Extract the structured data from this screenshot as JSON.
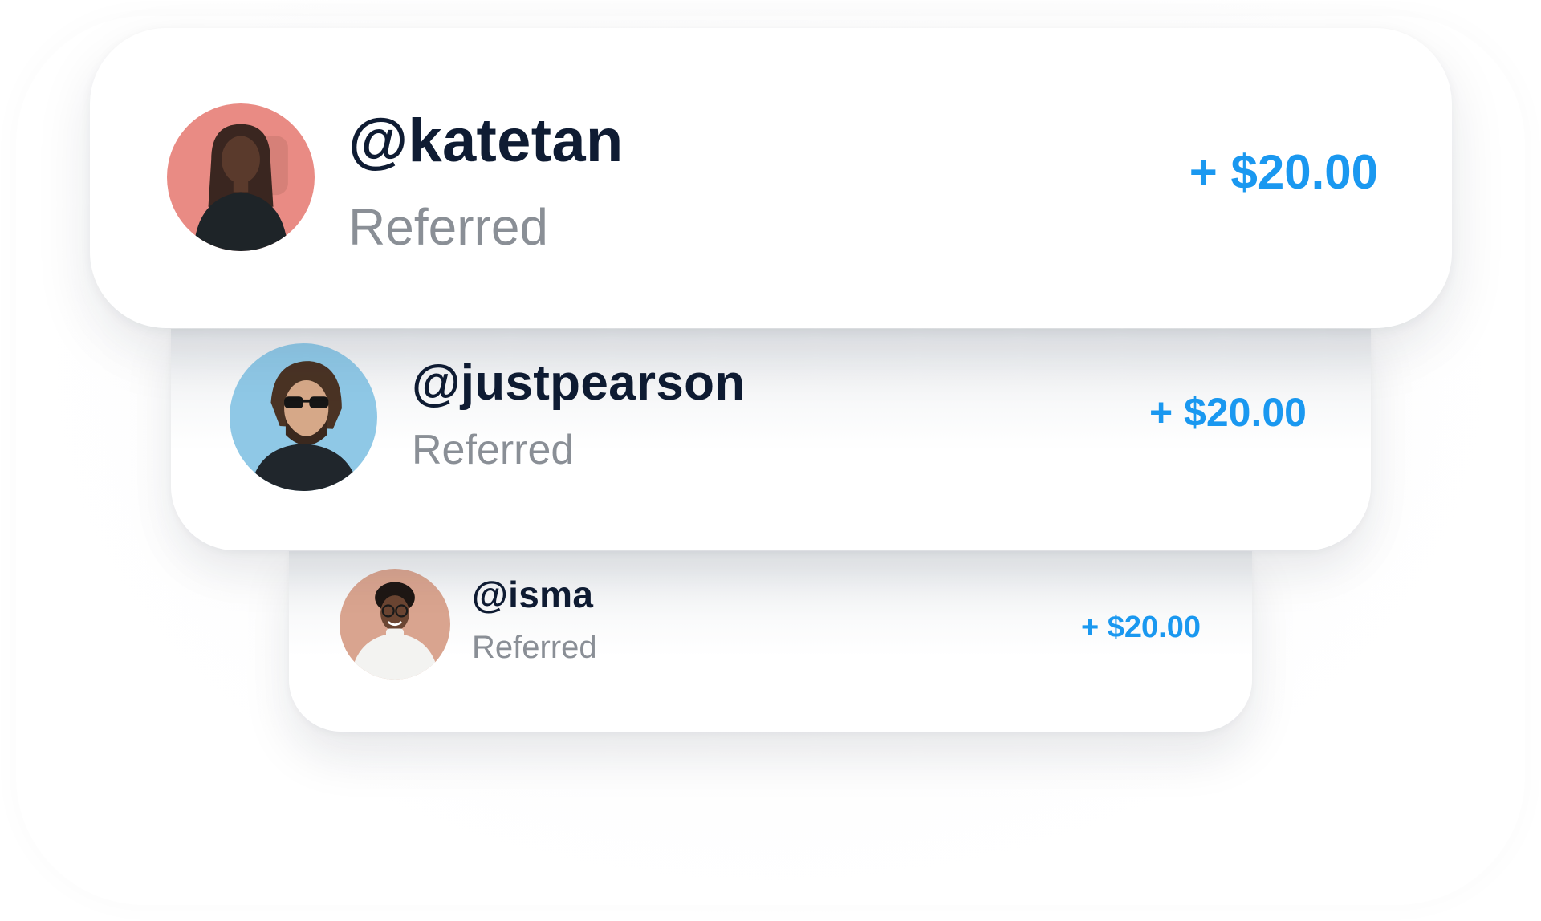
{
  "referrals": [
    {
      "handle": "@katetan",
      "status": "Referred",
      "amount": "+ $20.00",
      "avatar_icon": "person-avatar-icon",
      "avatar_bg": "#e98b84"
    },
    {
      "handle": "@justpearson",
      "status": "Referred",
      "amount": "+ $20.00",
      "avatar_icon": "person-avatar-icon",
      "avatar_bg": "#8fc8e6"
    },
    {
      "handle": "@isma",
      "status": "Referred",
      "amount": "+ $20.00",
      "avatar_icon": "person-avatar-icon",
      "avatar_bg": "#d9a48f"
    }
  ],
  "colors": {
    "handle": "#0f1c33",
    "status": "#8a8f96",
    "amount": "#1a98f0",
    "card": "#ffffff"
  }
}
